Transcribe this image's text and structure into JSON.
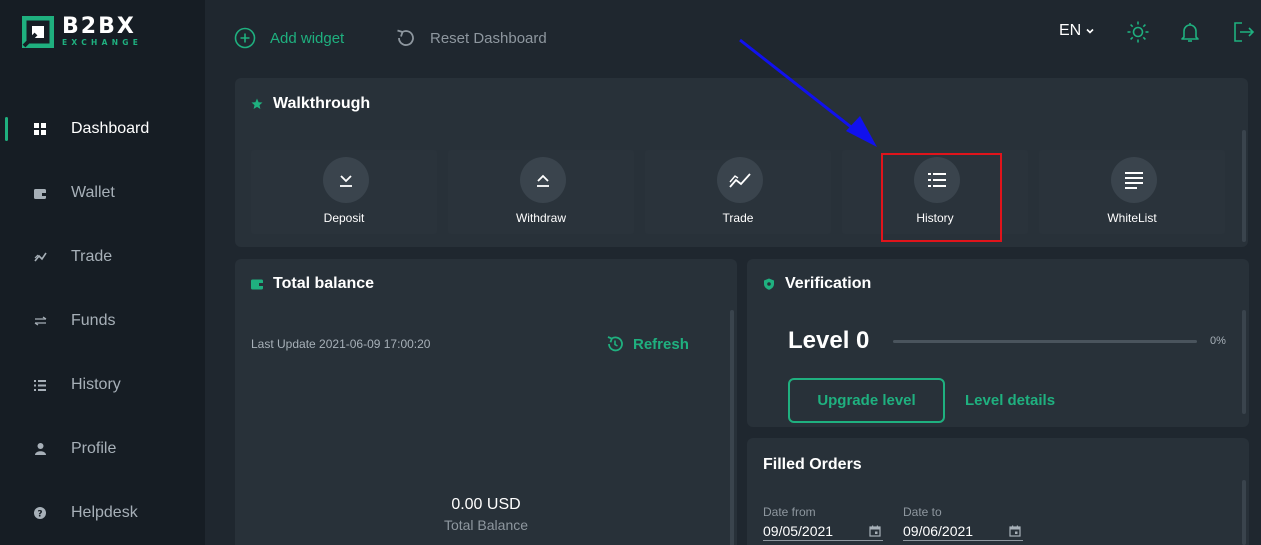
{
  "brand": {
    "name": "B2BX",
    "sub": "EXCHANGE",
    "accent": "#1fb07f"
  },
  "sidebar": {
    "items": [
      {
        "label": "Dashboard",
        "icon": "grid-icon",
        "active": true
      },
      {
        "label": "Wallet",
        "icon": "wallet-icon"
      },
      {
        "label": "Trade",
        "icon": "trend-icon"
      },
      {
        "label": "Funds",
        "icon": "exchange-arrows-icon"
      },
      {
        "label": "History",
        "icon": "list-icon"
      },
      {
        "label": "Profile",
        "icon": "user-icon"
      },
      {
        "label": "Helpdesk",
        "icon": "help-icon"
      }
    ]
  },
  "topbar": {
    "add_widget": "Add widget",
    "reset_dashboard": "Reset Dashboard",
    "language": "EN"
  },
  "walkthrough": {
    "title": "Walkthrough",
    "cards": [
      {
        "label": "Deposit",
        "icon": "download-icon"
      },
      {
        "label": "Withdraw",
        "icon": "upload-icon"
      },
      {
        "label": "Trade",
        "icon": "trend-icon"
      },
      {
        "label": "History",
        "icon": "list-icon"
      },
      {
        "label": "WhiteList",
        "icon": "lines-icon"
      }
    ]
  },
  "total_balance": {
    "title": "Total balance",
    "last_update": "Last Update 2021-06-09 17:00:20",
    "refresh": "Refresh",
    "value": "0.00 USD",
    "label": "Total Balance"
  },
  "verification": {
    "title": "Verification",
    "level": "Level 0",
    "progress": 0,
    "progress_label": "0%",
    "upgrade": "Upgrade level",
    "details": "Level details"
  },
  "filled_orders": {
    "title": "Filled Orders",
    "date_from_label": "Date from",
    "date_from": "09/05/2021",
    "date_to_label": "Date to",
    "date_to": "09/06/2021"
  }
}
